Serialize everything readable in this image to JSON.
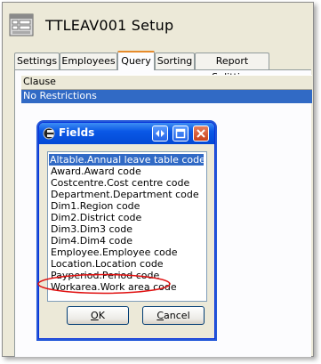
{
  "window": {
    "title": "TTLEAV001 Setup"
  },
  "tabs": [
    {
      "label": "Settings"
    },
    {
      "label": "Employees"
    },
    {
      "label": "Query"
    },
    {
      "label": "Sorting"
    },
    {
      "label": "Report Splitting"
    }
  ],
  "grid": {
    "header": "Clause",
    "rows": [
      {
        "text": "No Restrictions"
      }
    ]
  },
  "dialog": {
    "title": "Fields",
    "items": [
      "Altable.Annual leave table code",
      "Award.Award code",
      "Costcentre.Cost centre code",
      "Department.Department code",
      "Dim1.Region code",
      "Dim2.District code",
      "Dim3.Dim3 code",
      "Dim4.Dim4 code",
      "Employee.Employee code",
      "Location.Location code",
      "Payperiod.Period code",
      "Workarea.Work area code"
    ],
    "selected_index": 0,
    "ok": {
      "accel": "O",
      "rest": "K"
    },
    "cancel": {
      "accel": "C",
      "rest": "ancel"
    }
  },
  "colors": {
    "selection": "#316ac5",
    "highlight_ellipse": "#e01010"
  }
}
